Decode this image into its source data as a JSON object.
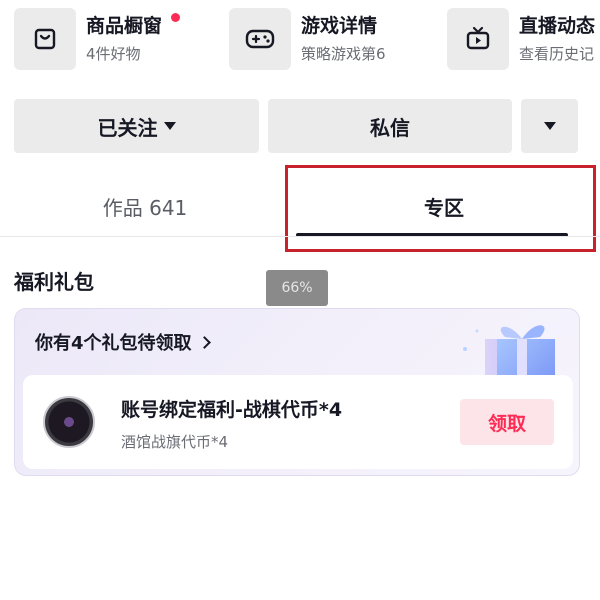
{
  "shortcuts": [
    {
      "title": "商品橱窗",
      "subtitle": "4件好物",
      "icon": "shop-bag-icon",
      "badge": true
    },
    {
      "title": "游戏详情",
      "subtitle": "策略游戏第6",
      "icon": "gamepad-icon",
      "badge": false
    },
    {
      "title": "直播动态",
      "subtitle": "查看历史记",
      "icon": "tv-icon",
      "badge": false
    }
  ],
  "actions": {
    "follow_label": "已关注",
    "message_label": "私信"
  },
  "tabs": [
    {
      "label": "作品 641",
      "active": false
    },
    {
      "label": "专区",
      "active": true
    }
  ],
  "zoom_level": "66%",
  "welfare": {
    "section_title": "福利礼包",
    "header": "你有4个礼包待领取",
    "item": {
      "title": "账号绑定福利-战棋代币*4",
      "subtitle": "酒馆战旗代币*4",
      "claim_label": "领取"
    }
  },
  "colors": {
    "accent": "#fe2c55",
    "highlight_box": "#c8232c",
    "button_bg": "#ebebeb"
  }
}
